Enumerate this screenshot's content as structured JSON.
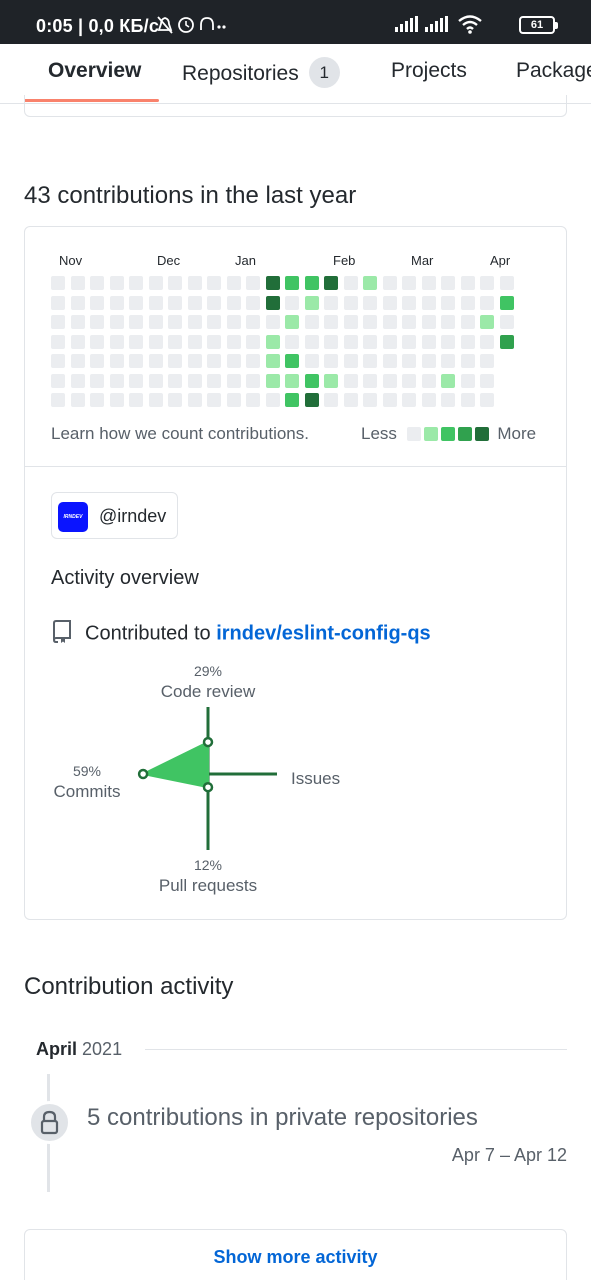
{
  "status_bar": {
    "time": "0:05 | 0,0 КБ/с",
    "battery": "61"
  },
  "tabs": [
    {
      "label": "Overview",
      "active": true
    },
    {
      "label": "Repositories",
      "counter": "1"
    },
    {
      "label": "Projects"
    },
    {
      "label": "Packages"
    }
  ],
  "contributions": {
    "heading": "43 contributions in the last year",
    "months": [
      "Nov",
      "Dec",
      "Jan",
      "Feb",
      "Mar",
      "Apr"
    ],
    "learn_link": "Learn how we count contributions.",
    "legend_less": "Less",
    "legend_more": "More",
    "colors": [
      "#ebedf0",
      "#9be9a8",
      "#40c463",
      "#30a14e",
      "#216e39"
    ],
    "activity_cells": [
      {
        "week": 11,
        "day": 0,
        "level": 4
      },
      {
        "week": 11,
        "day": 1,
        "level": 4
      },
      {
        "week": 11,
        "day": 3,
        "level": 2
      },
      {
        "week": 11,
        "day": 4,
        "level": 1
      },
      {
        "week": 11,
        "day": 5,
        "level": 1
      },
      {
        "week": 12,
        "day": 0,
        "level": 2
      },
      {
        "week": 12,
        "day": 2,
        "level": 1
      },
      {
        "week": 12,
        "day": 4,
        "level": 2
      },
      {
        "week": 12,
        "day": 5,
        "level": 1
      },
      {
        "week": 12,
        "day": 6,
        "level": 2
      },
      {
        "week": 13,
        "day": 0,
        "level": 2
      },
      {
        "week": 13,
        "day": 1,
        "level": 1
      },
      {
        "week": 13,
        "day": 5,
        "level": 2
      },
      {
        "week": 13,
        "day": 6,
        "level": 4
      },
      {
        "week": 14,
        "day": 0,
        "level": 4
      },
      {
        "week": 14,
        "day": 5,
        "level": 1
      },
      {
        "week": 16,
        "day": 0,
        "level": 1
      },
      {
        "week": 11,
        "day": 3,
        "level": 1
      },
      {
        "week": 20,
        "day": 5,
        "level": 1
      },
      {
        "week": 22,
        "day": 2,
        "level": 1
      },
      {
        "week": 23,
        "day": 1,
        "level": 2
      },
      {
        "week": 23,
        "day": 3,
        "level": 3
      }
    ]
  },
  "activity": {
    "org_handle": "@irndev",
    "org_avatar_text": "IRNDEV",
    "title": "Activity overview",
    "contributed_prefix": "Contributed to",
    "repo": "irndev/eslint-config-qs",
    "radar": {
      "code_review_pct": "29%",
      "code_review_label": "Code review",
      "commits_pct": "59%",
      "commits_label": "Commits",
      "issues_label": "Issues",
      "pull_requests_pct": "12%",
      "pull_requests_label": "Pull requests",
      "values": {
        "code_review": 29,
        "commits": 59,
        "issues": 0,
        "pull_requests": 12
      }
    }
  },
  "contribution_activity": {
    "heading": "Contribution activity",
    "month": "April",
    "year": "2021",
    "private_text": "5 contributions in private repositories",
    "date_range": "Apr 7 – Apr 12",
    "show_more": "Show more activity"
  }
}
